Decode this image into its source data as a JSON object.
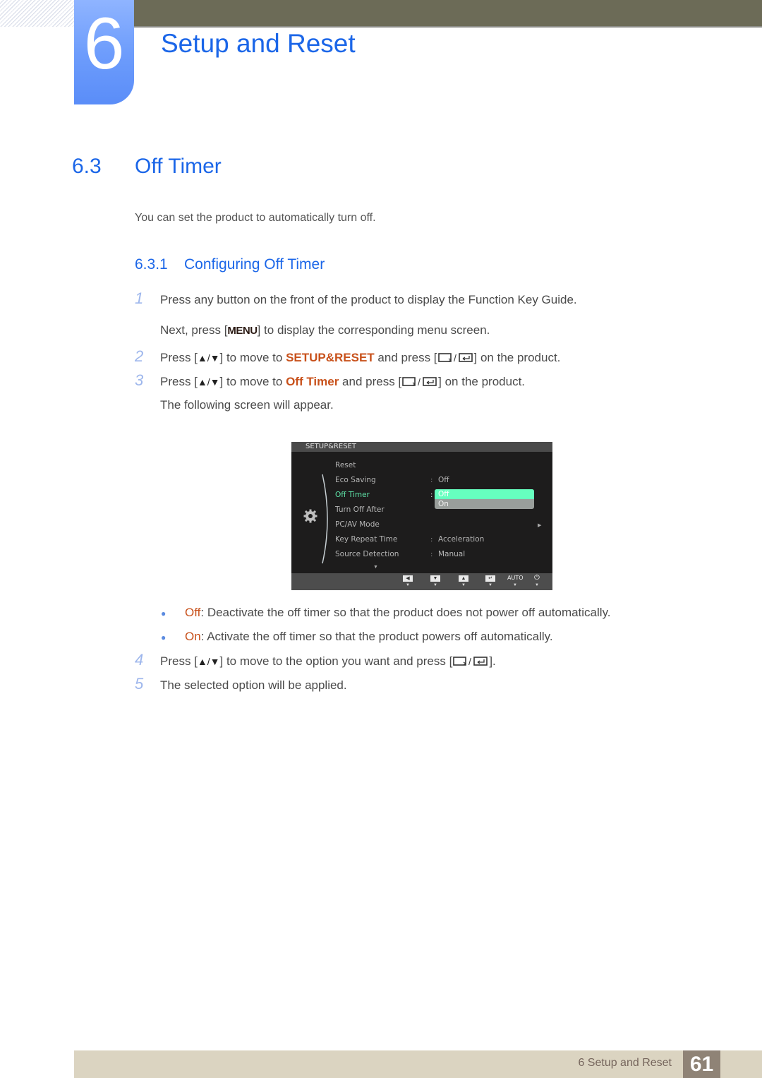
{
  "chapter": {
    "number": "6",
    "title": "Setup and Reset"
  },
  "section": {
    "number": "6.3",
    "title": "Off Timer"
  },
  "intro": "You can set the product to automatically turn off.",
  "subsection": {
    "number": "6.3.1",
    "title": "Configuring Off Timer"
  },
  "steps": {
    "s1": {
      "num": "1",
      "text": "Press any button on the front of the product to display the Function Key Guide."
    },
    "s1b": {
      "pre": "Next, press [",
      "key": "MENU",
      "post": "] to display the corresponding menu screen."
    },
    "s2": {
      "num": "2",
      "pre": "Press [",
      "mid": "] to move to ",
      "target": "SETUP&RESET",
      "post1": " and press [",
      "post2": "] on the product."
    },
    "s3": {
      "num": "3",
      "pre": "Press [",
      "mid": "] to move to ",
      "target": "Off Timer",
      "post1": " and press [",
      "post2": "] on the product."
    },
    "s3b": {
      "text": "The following screen will appear."
    },
    "s4": {
      "num": "4",
      "pre": "Press [",
      "mid": "] to move to the option you want and press [",
      "post": "]."
    },
    "s5": {
      "num": "5",
      "text": "The selected option will be applied."
    }
  },
  "bullets": [
    {
      "term": "Off",
      "text": ": Deactivate the off timer so that the product does not power off automatically."
    },
    {
      "term": "On",
      "text": ": Activate the off timer so that the product powers off automatically."
    }
  ],
  "osd": {
    "header": "SETUP&RESET",
    "items": [
      {
        "label": "Reset",
        "value": ""
      },
      {
        "label": "Eco Saving",
        "value": "Off"
      },
      {
        "label": "Off Timer",
        "value": ""
      },
      {
        "label": "Turn Off After",
        "value": ""
      },
      {
        "label": "PC/AV Mode",
        "value": ""
      },
      {
        "label": "Key Repeat Time",
        "value": "Acceleration"
      },
      {
        "label": "Source Detection",
        "value": "Manual"
      }
    ],
    "active_item": "Off Timer",
    "dropdown": {
      "options": [
        "Off",
        "On"
      ],
      "selected": "Off"
    },
    "footer": {
      "auto_label": "AUTO"
    }
  },
  "footer": {
    "label": "6 Setup and Reset",
    "page": "61"
  },
  "colors": {
    "accent": "#1b66e8",
    "highlight": "#c8511b",
    "osd_active": "#5ee3a8",
    "topbar": "#6c6b57"
  }
}
